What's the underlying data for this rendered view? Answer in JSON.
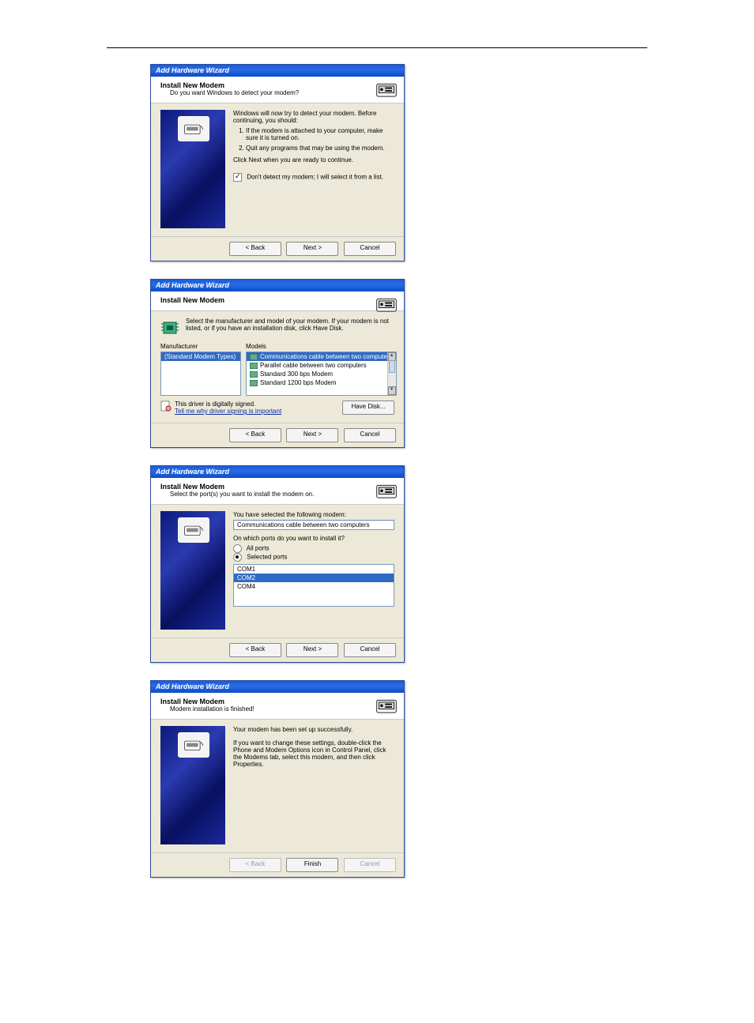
{
  "wizard_title": "Add Hardware Wizard",
  "header_title": "Install New Modem",
  "buttons": {
    "back": "< Back",
    "next": "Next >",
    "cancel": "Cancel",
    "finish": "Finish",
    "have_disk": "Have Disk..."
  },
  "dlg1": {
    "subtitle": "Do you want Windows to detect your modem?",
    "intro": "Windows will now try to detect your modem. Before continuing, you should:",
    "step1": "If the modem is attached to your computer, make sure it is turned on.",
    "step2": "Quit any programs that may be using the modem.",
    "proceed": "Click Next when you are ready to continue.",
    "checkbox_label": "Don't detect my modem; I will select it from a list."
  },
  "dlg2": {
    "instruction": "Select the manufacturer and model of your modem. If your modem is not listed, or if you have an installation disk, click Have Disk.",
    "manufacturer_label": "Manufacturer",
    "models_label": "Models",
    "manufacturers": [
      "(Standard Modem Types)"
    ],
    "models": [
      "Communications cable between two computers",
      "Parallel cable between two computers",
      "Standard    300 bps Modem",
      "Standard  1200 bps Modem"
    ],
    "signed_text": "This driver is digitally signed.",
    "signing_link": "Tell me why driver signing is important"
  },
  "dlg3": {
    "subtitle": "Select the port(s) you want to install the modem on.",
    "selected_intro": "You have selected the following modem:",
    "selected_modem": "Communications cable between two computers",
    "ports_question": "On which ports do you want to install it?",
    "radio_all": "All ports",
    "radio_selected": "Selected ports",
    "ports": [
      "COM1",
      "COM2",
      "COM4"
    ]
  },
  "dlg4": {
    "subtitle": "Modem installation is finished!",
    "msg1": "Your modem has been set up successfully.",
    "msg2": "If you want to change these settings, double-click the Phone and Modem Options icon in Control Panel, click the Modems tab, select this modem, and then click Properties."
  }
}
